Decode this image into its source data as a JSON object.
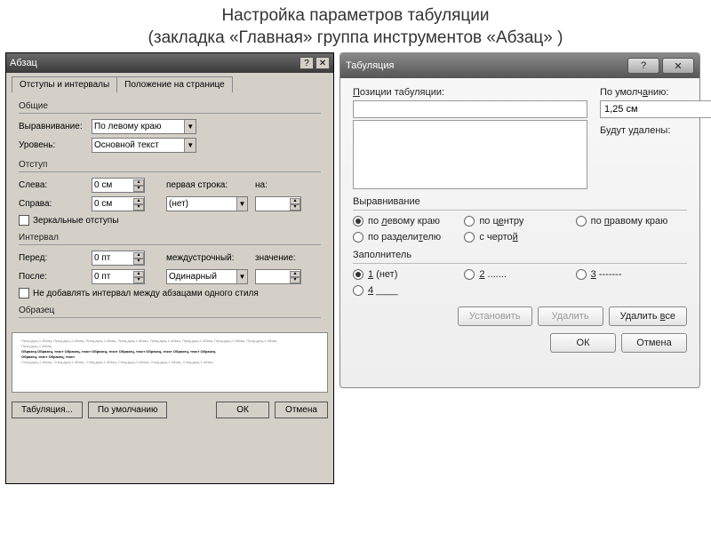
{
  "page": {
    "title_line1": "Настройка параметров табуляции",
    "title_line2": "(закладка «Главная» группа инструментов «Абзац» )"
  },
  "para": {
    "title": "Абзац",
    "tabs": [
      "Отступы и интервалы",
      "Положение на странице"
    ],
    "group_general": "Общие",
    "align_label": "Выравнивание:",
    "align_value": "По левому краю",
    "level_label": "Уровень:",
    "level_value": "Основной текст",
    "group_indent": "Отступ",
    "left_label": "Слева:",
    "left_value": "0 см",
    "right_label": "Справа:",
    "right_value": "0 см",
    "firstline_label": "первая строка:",
    "firstline_value": "(нет)",
    "by_label": "на:",
    "by_value": "",
    "mirror": "Зеркальные отступы",
    "group_spacing": "Интервал",
    "before_label": "Перед:",
    "before_value": "0 пт",
    "after_label": "После:",
    "after_value": "0 пт",
    "linesp_label": "междустрочный:",
    "linesp_value": "Одинарный",
    "val_label": "значение:",
    "val_value": "",
    "nospace": "Не добавлять интервал между абзацами одного стиля",
    "sample_label": "Образец",
    "btn_tabs": "Табуляция...",
    "btn_default": "По умолчанию",
    "btn_ok": "ОК",
    "btn_cancel": "Отмена"
  },
  "tab": {
    "title": "Табуляция",
    "pos_label": "Позиции табуляции:",
    "pos_value": "",
    "default_label": "По умолчанию:",
    "default_value": "1,25 см",
    "cleared": "Будут удалены:",
    "align_label": "Выравнивание",
    "align_opts": [
      "по левому краю",
      "по центру",
      "по правому краю",
      "по разделителю",
      "с чертой"
    ],
    "leader_label": "Заполнитель",
    "leader_opts": [
      "1 (нет)",
      "2 .......",
      "3 -------",
      "4 ____"
    ],
    "btn_set": "Установить",
    "btn_clear": "Удалить",
    "btn_clearall": "Удалить все",
    "btn_ok": "ОК",
    "btn_cancel": "Отмена"
  }
}
